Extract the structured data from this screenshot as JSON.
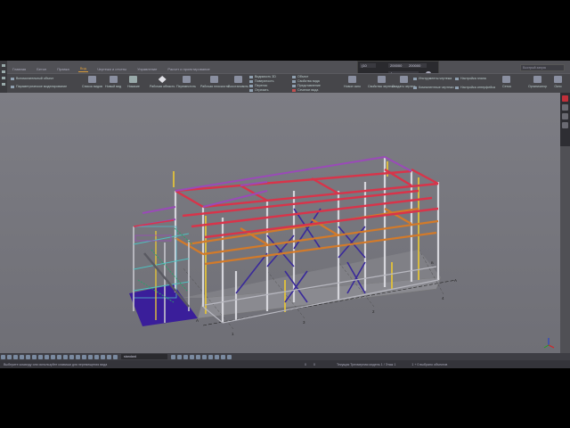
{
  "menu_tabs": [
    "Главная",
    "Бетон",
    "Правка",
    "Вид",
    "Чертежи и отчеты",
    "Управление",
    "Расчет и проектирование"
  ],
  "active_tab": "Вид",
  "coord_panel": {
    "value1": "(10",
    "value2": "200000",
    "value3": "200000",
    "unit": "Ангелия"
  },
  "search_placeholder": "Быстрый запуск",
  "ribbon": {
    "small_left": [
      "Вспомогательный объект",
      "Параметрическое моделирование"
    ],
    "buttons": [
      "Список видов",
      "Новый вид",
      "Никакие",
      "Рабочая область",
      "Переместить",
      "Рабочая плоскость",
      "Восстановить"
    ],
    "view_options": [
      "Видимость 3D",
      "Поверхность",
      "Перенос",
      "Отрезать"
    ],
    "list_items": [
      "Объект",
      "Свойства вида",
      "Представление",
      "Сечение вида"
    ],
    "right_buttons": [
      "Новое окно",
      "Свойства чертежа",
      "Создать чертеж"
    ],
    "right_small": [
      "Инструменты чертежа",
      "Настройка плана",
      "Просмотр"
    ],
    "far_right": [
      "Сетка",
      "Организатор",
      "Окно"
    ],
    "dropdowns": [
      "Компонентные чертежи",
      "Настройка интерфейса"
    ]
  },
  "axis_labels": {
    "a_left": "A",
    "a_right": "A",
    "num1": "1",
    "num2": "2",
    "num3": "3",
    "num4": "4",
    "b": "B"
  },
  "command_field": "standard",
  "status": {
    "message": "Выберите команду или используйте клавиши для перемещения вида",
    "pan": "0",
    "ortho": "0",
    "mode": "Текущая Трехмерная модель 1 / Этаж 1",
    "selection": "1 + 0 выбрано объектов"
  }
}
